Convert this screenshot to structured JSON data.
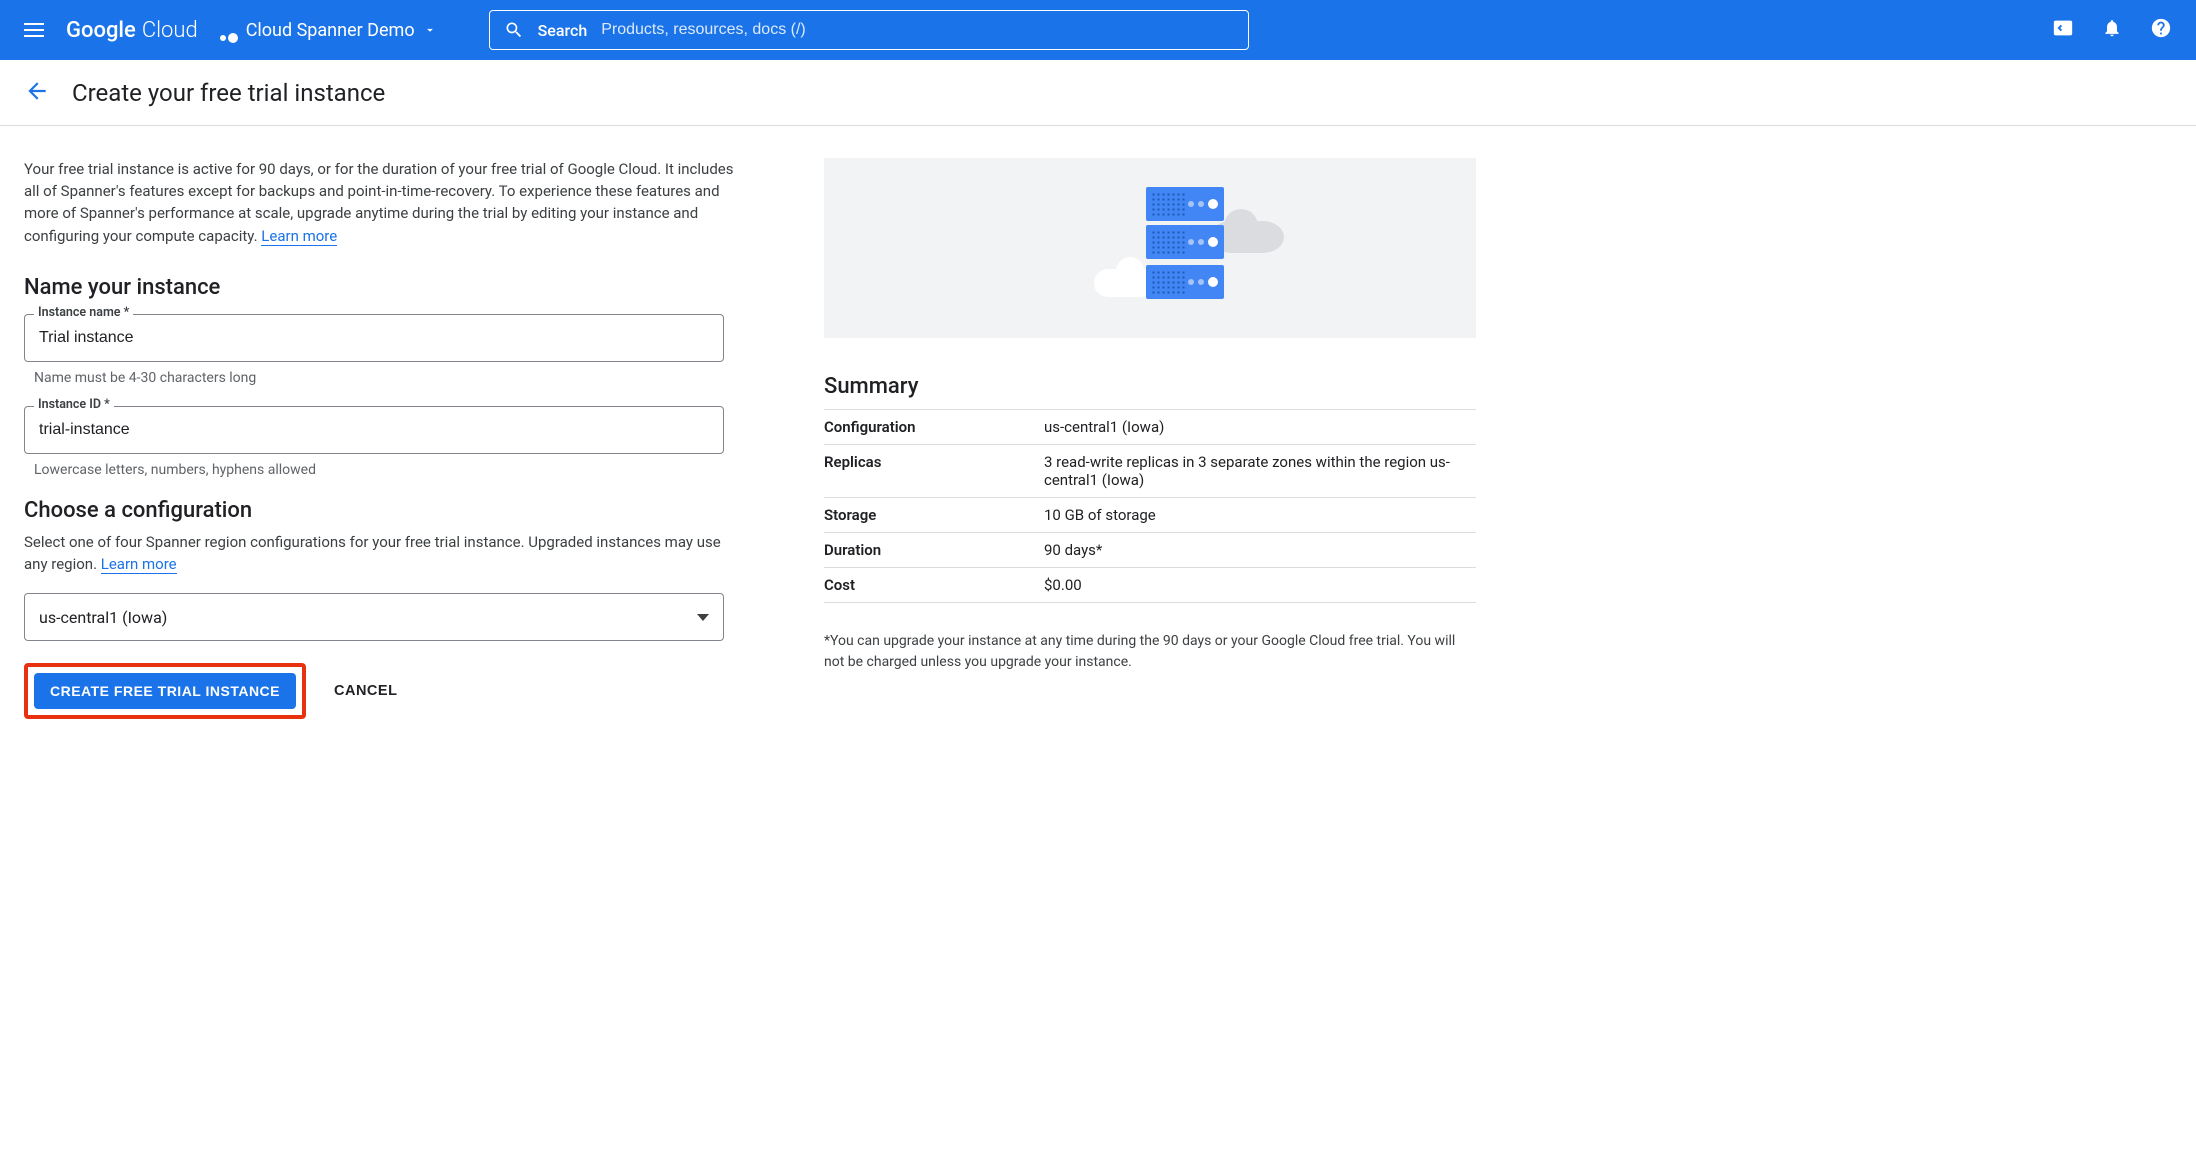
{
  "header": {
    "logo_google": "Google",
    "logo_cloud": "Cloud",
    "project_name": "Cloud Spanner Demo",
    "search_label": "Search",
    "search_placeholder": "Products, resources, docs (/)"
  },
  "page": {
    "title": "Create your free trial instance",
    "intro": "Your free trial instance is active for 90 days, or for the duration of your free trial of Google Cloud. It includes all of Spanner's features except for backups and point-in-time-recovery. To experience these features and more of Spanner's performance at scale, upgrade anytime during the trial by editing your instance and configuring your compute capacity. ",
    "learn_more": "Learn more"
  },
  "name_section": {
    "heading": "Name your instance",
    "instance_name_label": "Instance name *",
    "instance_name_value": "Trial instance",
    "instance_name_hint": "Name must be 4-30 characters long",
    "instance_id_label": "Instance ID *",
    "instance_id_value": "trial-instance",
    "instance_id_hint": "Lowercase letters, numbers, hyphens allowed"
  },
  "config_section": {
    "heading": "Choose a configuration",
    "desc": "Select one of four Spanner region configurations for your free trial instance. Upgraded instances may use any region. ",
    "learn_more": "Learn more",
    "selected": "us-central1 (Iowa)"
  },
  "actions": {
    "create": "CREATE FREE TRIAL INSTANCE",
    "cancel": "CANCEL"
  },
  "summary": {
    "heading": "Summary",
    "rows": [
      {
        "k": "Configuration",
        "v": "us-central1 (Iowa)"
      },
      {
        "k": "Replicas",
        "v": "3 read-write replicas in 3 separate zones within the region us-central1 (Iowa)"
      },
      {
        "k": "Storage",
        "v": "10 GB of storage"
      },
      {
        "k": "Duration",
        "v": "90 days*"
      },
      {
        "k": "Cost",
        "v": "$0.00"
      }
    ],
    "footnote": "*You can upgrade your instance at any time during the 90 days or your Google Cloud free trial. You will not be charged unless you upgrade your instance."
  }
}
